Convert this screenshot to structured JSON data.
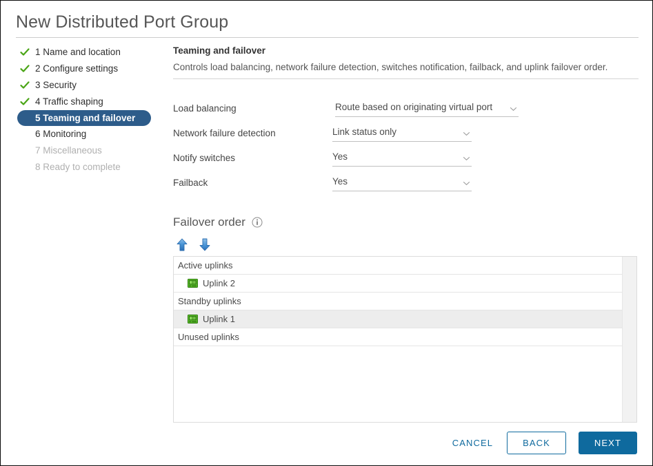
{
  "window": {
    "title": "New Distributed Port Group"
  },
  "sidebar": {
    "steps": [
      {
        "number": "1",
        "label": "1 Name and location",
        "state": "done"
      },
      {
        "number": "2",
        "label": "2 Configure settings",
        "state": "done"
      },
      {
        "number": "3",
        "label": "3 Security",
        "state": "done"
      },
      {
        "number": "4",
        "label": "4 Traffic shaping",
        "state": "done"
      },
      {
        "number": "5",
        "label": "5 Teaming and failover",
        "state": "current"
      },
      {
        "number": "6",
        "label": "6 Monitoring",
        "state": "upcoming"
      },
      {
        "number": "7",
        "label": "7 Miscellaneous",
        "state": "disabled"
      },
      {
        "number": "8",
        "label": "8 Ready to complete",
        "state": "disabled"
      }
    ]
  },
  "main": {
    "section_title": "Teaming and failover",
    "section_desc": "Controls load balancing, network failure detection, switches notification, failback, and uplink failover order.",
    "fields": [
      {
        "label": "Load balancing",
        "value": "Route based on originating virtual port",
        "width": "wide"
      },
      {
        "label": "Network failure detection",
        "value": "Link status only",
        "width": "narrow"
      },
      {
        "label": "Notify switches",
        "value": "Yes",
        "width": "narrow"
      },
      {
        "label": "Failback",
        "value": "Yes",
        "width": "narrow"
      }
    ],
    "failover": {
      "title": "Failover order",
      "move_up_label": "Move up",
      "move_down_label": "Move down",
      "rows": [
        {
          "type": "group",
          "label": "Active uplinks",
          "selected": false
        },
        {
          "type": "item",
          "label": "Uplink 2",
          "selected": false
        },
        {
          "type": "group",
          "label": "Standby uplinks",
          "selected": false
        },
        {
          "type": "item",
          "label": "Uplink 1",
          "selected": true
        },
        {
          "type": "group",
          "label": "Unused uplinks",
          "selected": false
        }
      ]
    }
  },
  "footer": {
    "cancel_label": "CANCEL",
    "back_label": "BACK",
    "next_label": "NEXT"
  },
  "colors": {
    "accent": "#0f6a9e",
    "step_current_bg": "#2d5c8a",
    "check_green": "#4aa516",
    "selected_row": "#ededed"
  }
}
